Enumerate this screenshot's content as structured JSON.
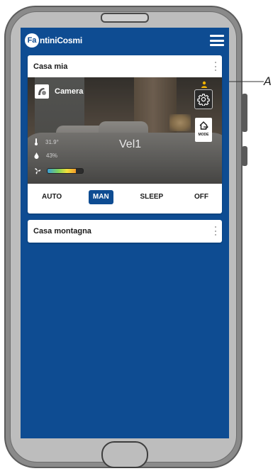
{
  "colors": {
    "accent": "#0e4c92",
    "card_background": "#ffffff",
    "user_icon": "#f2b400"
  },
  "app": {
    "logo_mark": "Fa",
    "logo_text": "ntiniCosmi"
  },
  "homes": [
    {
      "name": "Casa mia",
      "room": {
        "name": "Camera",
        "temperature": "31.9°",
        "humidity": "43%",
        "speed_label": "Vel1",
        "mode_button_label": "MODE"
      },
      "modes": [
        {
          "label": "AUTO",
          "active": false
        },
        {
          "label": "MAN",
          "active": true
        },
        {
          "label": "SLEEP",
          "active": false
        },
        {
          "label": "OFF",
          "active": false
        }
      ]
    },
    {
      "name": "Casa montagna"
    }
  ],
  "callout_label": "A"
}
